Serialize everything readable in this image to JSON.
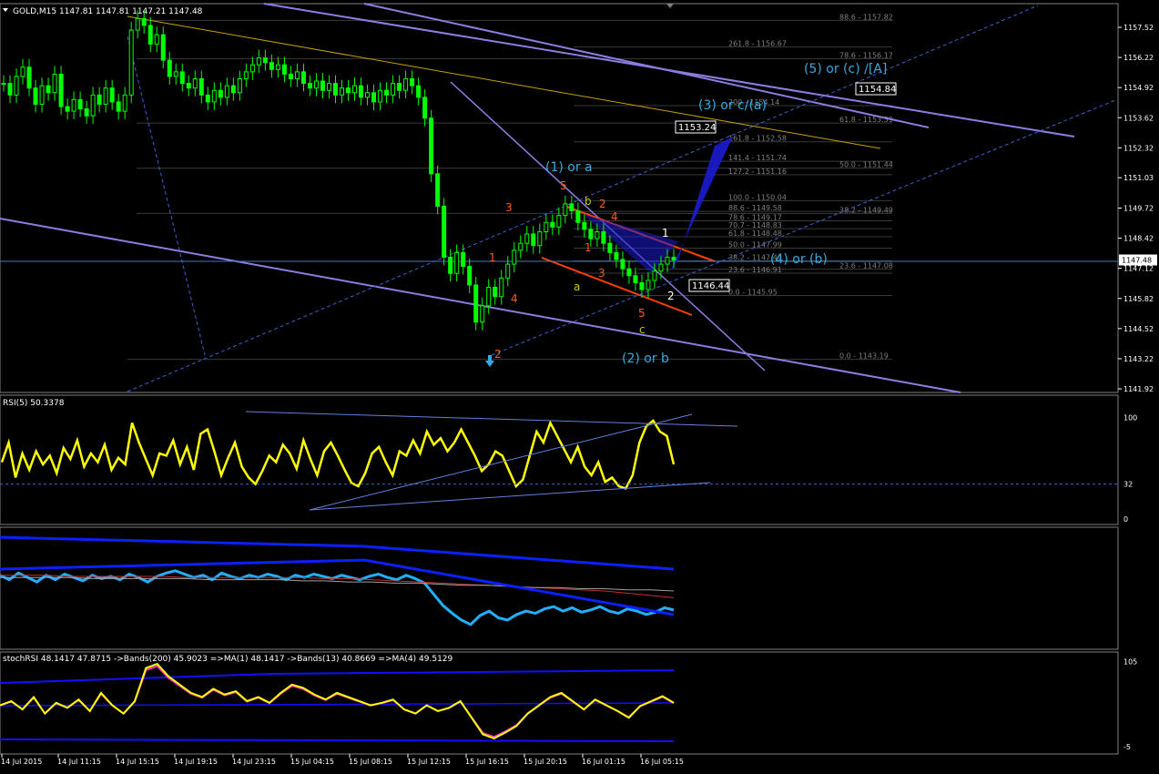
{
  "chart_header": {
    "title": "GOLD,M15  1147.81 1147.81 1147.21 1147.48"
  },
  "colors": {
    "background": "#000000",
    "candles": "#00ff00",
    "channel": "#8a7fe0",
    "rsi_line": "#ffff00",
    "stoch_main": "#ffff00",
    "stoch_ma": "#ff33cc",
    "bands": "#0000ff",
    "price_line": "#20a8ff",
    "wave_labels": "#3aa8e0",
    "wave_numbers_red": "#ff5a1f",
    "wave_numbers_white": "#ffffff"
  },
  "chart_data": [
    {
      "type": "candlestick",
      "title": "GOLD,M15",
      "price_axis_ticks": [
        "1157.52",
        "1156.22",
        "1154.92",
        "1153.62",
        "1152.32",
        "1151.03",
        "1149.72",
        "1148.42",
        "1147.12",
        "1145.82",
        "1144.52",
        "1143.22",
        "1141.92"
      ],
      "current_price": "1147.48",
      "price_markers": [
        "1154.84",
        "1153.24",
        "1146.44"
      ],
      "time_axis_ticks": [
        "14 Jul 2015",
        "14 Jul 11:15",
        "14 Jul 15:15",
        "14 Jul 19:15",
        "14 Jul 23:15",
        "15 Jul 04:15",
        "15 Jul 08:15",
        "15 Jul 12:15",
        "15 Jul 16:15",
        "15 Jul 20:15",
        "16 Jul 01:15",
        "16 Jul 05:15"
      ],
      "ylim": [
        1141.92,
        1158.2
      ],
      "fib_levels_top": [
        {
          "label": "88.6 - 1157.82",
          "value": 1157.82
        },
        {
          "label": "261.8 - 1156.67",
          "value": 1156.67
        },
        {
          "label": "78.6 - 1156.17",
          "value": 1156.17
        },
        {
          "label": "200 - 1154.14",
          "value": 1154.14
        },
        {
          "label": "61.8 - 1153.39",
          "value": 1153.39
        },
        {
          "label": "161.8 - 1152.58",
          "value": 1152.58
        },
        {
          "label": "141.4 - 1151.74",
          "value": 1151.74
        },
        {
          "label": "50.0 - 1151.44",
          "value": 1151.44
        },
        {
          "label": "127.2 - 1151.16",
          "value": 1151.16
        },
        {
          "label": "100.0 - 1150.04",
          "value": 1150.04
        },
        {
          "label": "88.6 - 1149.58",
          "value": 1149.58
        },
        {
          "label": "38.2 - 1149.49",
          "value": 1149.49
        },
        {
          "label": "78.6 - 1149.17",
          "value": 1149.17
        },
        {
          "label": "70.7 - 1148.83",
          "value": 1148.83
        },
        {
          "label": "61.8 - 1148.48",
          "value": 1148.48
        },
        {
          "label": "50.0 - 1147.99",
          "value": 1147.99
        },
        {
          "label": "38.2 - 1147.44",
          "value": 1147.44
        },
        {
          "label": "23.6 - 1147.08",
          "value": 1147.08
        },
        {
          "label": "23.6 - 1146.91",
          "value": 1146.91
        },
        {
          "label": "0.0 - 1145.95",
          "value": 1145.95
        },
        {
          "label": "0.0 - 1143.19",
          "value": 1143.19
        }
      ],
      "wave_annotations": [
        {
          "text": "(5) or (c) /[A]",
          "x_time": "16 Jul 12:00",
          "y": 1155.6
        },
        {
          "text": "(3) or c/(a)",
          "x_time": "16 Jul 06:30",
          "y": 1153.8
        },
        {
          "text": "(1) or a",
          "x_time": "15 Jul 21:30",
          "y": 1151.3
        },
        {
          "text": "(4) or (b)",
          "x_time": "16 Jul 07:15",
          "y": 1147.5
        },
        {
          "text": "(2) or b",
          "x_time": "16 Jul 01:15",
          "y": 1143.1
        }
      ],
      "wave_counts": [
        {
          "text": "5",
          "color": "red"
        },
        {
          "text": "b",
          "color": "yellow"
        },
        {
          "text": "2",
          "color": "red"
        },
        {
          "text": "3",
          "color": "red"
        },
        {
          "text": "4",
          "color": "red"
        },
        {
          "text": "1",
          "color": "red"
        },
        {
          "text": "1",
          "color": "red"
        },
        {
          "text": "3",
          "color": "red"
        },
        {
          "text": "4",
          "color": "red"
        },
        {
          "text": "2",
          "color": "red"
        },
        {
          "text": "a",
          "color": "yellow"
        },
        {
          "text": "5",
          "color": "red"
        },
        {
          "text": "c",
          "color": "yellow"
        },
        {
          "text": "1",
          "color": "white"
        },
        {
          "text": "2",
          "color": "white"
        }
      ],
      "close": [
        1155.1,
        1154.6,
        1155.4,
        1155.8,
        1154.9,
        1154.2,
        1155.0,
        1154.7,
        1155.5,
        1154.1,
        1153.9,
        1154.4,
        1154.0,
        1153.7,
        1154.6,
        1154.2,
        1154.9,
        1154.3,
        1153.9,
        1154.6,
        1157.4,
        1157.9,
        1157.6,
        1156.8,
        1157.2,
        1156.1,
        1155.4,
        1155.6,
        1155.1,
        1154.9,
        1155.3,
        1154.6,
        1154.3,
        1154.8,
        1154.5,
        1155.0,
        1154.7,
        1155.3,
        1155.6,
        1155.9,
        1156.2,
        1156.0,
        1155.7,
        1155.9,
        1155.5,
        1155.3,
        1155.6,
        1155.1,
        1154.9,
        1155.2,
        1154.8,
        1155.1,
        1154.6,
        1154.9,
        1154.7,
        1155.0,
        1154.5,
        1154.7,
        1154.3,
        1154.8,
        1154.6,
        1155.1,
        1154.8,
        1155.3,
        1155.0,
        1154.5,
        1153.6,
        1151.2,
        1149.8,
        1147.6,
        1146.9,
        1147.8,
        1147.2,
        1146.4,
        1144.8,
        1145.5,
        1146.3,
        1145.9,
        1146.7,
        1147.3,
        1147.9,
        1148.2,
        1148.6,
        1148.1,
        1148.7,
        1149.1,
        1148.9,
        1149.4,
        1149.9,
        1149.6,
        1149.1,
        1148.8,
        1148.4,
        1148.7,
        1148.2,
        1147.8,
        1147.5,
        1147.1,
        1146.8,
        1146.5,
        1146.2,
        1146.6,
        1147.0,
        1147.3,
        1147.6,
        1147.48
      ],
      "rsi": {
        "label": "RSI(5) 50.3378",
        "levels": [
          "100",
          "32",
          "0"
        ],
        "ylim": [
          0,
          100
        ],
        "values": [
          52,
          70,
          38,
          60,
          45,
          62,
          50,
          58,
          42,
          65,
          55,
          72,
          48,
          60,
          52,
          68,
          45,
          56,
          50,
          88,
          70,
          55,
          40,
          60,
          58,
          72,
          50,
          66,
          45,
          78,
          82,
          62,
          40,
          56,
          70,
          48,
          38,
          32,
          44,
          58,
          52,
          68,
          60,
          46,
          72,
          55,
          40,
          62,
          70,
          58,
          45,
          33,
          30,
          42,
          60,
          66,
          52,
          40,
          62,
          58,
          72,
          60,
          80,
          68,
          74,
          62,
          70,
          82,
          70,
          58,
          44,
          50,
          62,
          58,
          44,
          30,
          36,
          58,
          80,
          70,
          88,
          76,
          64,
          52,
          66,
          48,
          40,
          52,
          34,
          38,
          30,
          28,
          40,
          70,
          85,
          90,
          80,
          76,
          50
        ]
      },
      "ma_panel": {
        "label": "",
        "ylim": [
          0,
          100
        ],
        "price_proxy": [
          62,
          58,
          64,
          60,
          56,
          62,
          58,
          63,
          60,
          57,
          62,
          59,
          61,
          58,
          63,
          60,
          56,
          61,
          64,
          66,
          63,
          60,
          62,
          58,
          64,
          61,
          59,
          62,
          60,
          63,
          61,
          58,
          62,
          60,
          63,
          61,
          59,
          62,
          60,
          58,
          61,
          63,
          60,
          58,
          62,
          59,
          55,
          45,
          35,
          28,
          22,
          18,
          26,
          30,
          24,
          22,
          27,
          30,
          28,
          32,
          34,
          30,
          33,
          29,
          31,
          34,
          30,
          28,
          32,
          30,
          27,
          29,
          33,
          31
        ],
        "ma_slow_red": [
          62,
          62,
          62,
          61,
          61,
          61,
          61,
          61,
          60,
          60,
          60,
          60,
          60,
          60,
          59,
          59,
          58,
          57,
          56,
          55,
          54,
          53,
          52,
          51,
          50,
          49,
          48,
          46,
          44,
          42
        ],
        "ma_slow_white": [
          60,
          60,
          60,
          60,
          59,
          59,
          59,
          59,
          59,
          58,
          58,
          58,
          58,
          57,
          57,
          56,
          56,
          55,
          55,
          54,
          53,
          53,
          52,
          51,
          51,
          50,
          50,
          49,
          49,
          48
        ]
      },
      "stoch_rsi": {
        "label": "stochRSI 48.1417 47.8715 ->Bands(200) 45.9023 =>MA(1) 48.1417 ->Bands(13) 40.8669 =>MA(4) 49.5129",
        "levels": [
          "105",
          "-5"
        ],
        "ylim": [
          -5,
          105
        ],
        "values": [
          45,
          50,
          40,
          55,
          35,
          48,
          42,
          52,
          38,
          60,
          45,
          35,
          50,
          90,
          95,
          80,
          70,
          60,
          55,
          65,
          58,
          62,
          50,
          55,
          48,
          60,
          70,
          66,
          58,
          52,
          60,
          55,
          50,
          45,
          48,
          52,
          40,
          35,
          45,
          38,
          42,
          50,
          30,
          10,
          5,
          12,
          20,
          35,
          45,
          55,
          60,
          50,
          40,
          52,
          45,
          38,
          30,
          44,
          50,
          56,
          48
        ]
      }
    }
  ]
}
